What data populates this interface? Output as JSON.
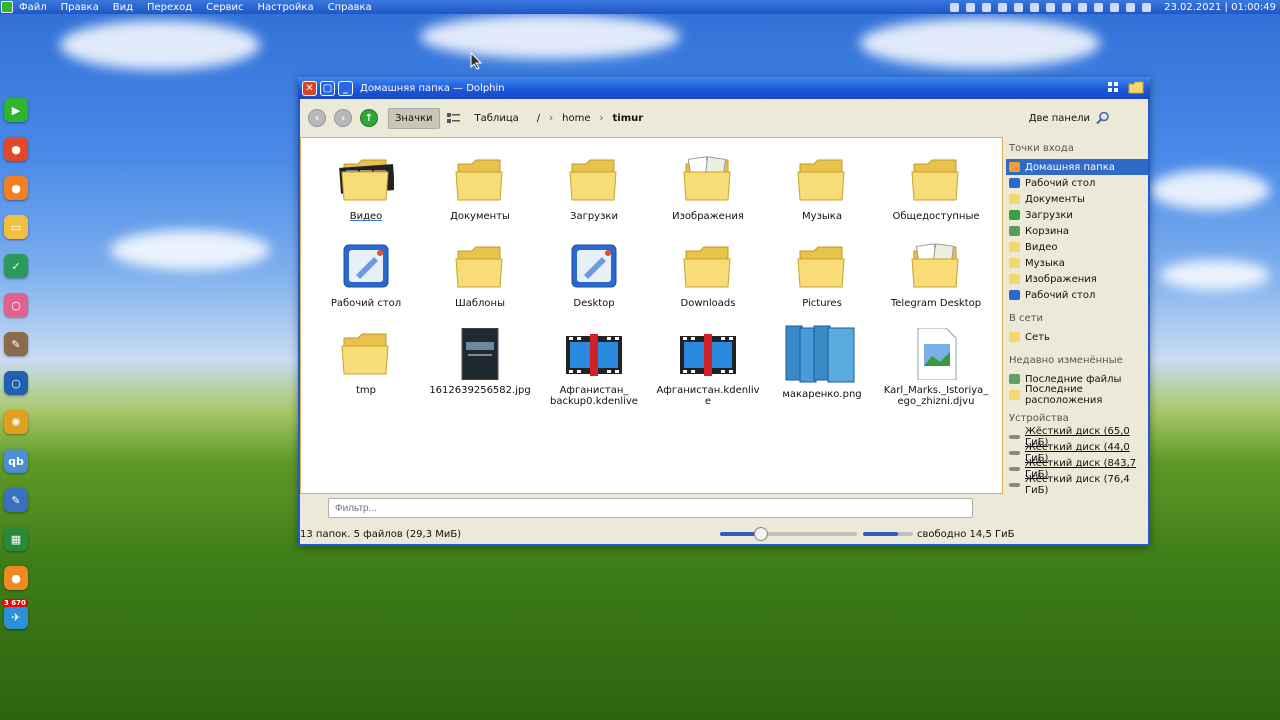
{
  "menubar": {
    "items": [
      "Файл",
      "Правка",
      "Вид",
      "Переход",
      "Сервис",
      "Настройка",
      "Справка"
    ],
    "clock": "23.02.2021 | 01:00:49"
  },
  "dock": {
    "items": [
      {
        "name": "play-icon",
        "color": "#2fb52f",
        "glyph": "▶"
      },
      {
        "name": "chrome-icon",
        "color": "#e04a2a",
        "glyph": "●"
      },
      {
        "name": "firefox-icon",
        "color": "#f08020",
        "glyph": "●"
      },
      {
        "name": "folder-icon",
        "color": "#f0c040",
        "glyph": "▭"
      },
      {
        "name": "graph-icon",
        "color": "#2a9a5a",
        "glyph": "✓"
      },
      {
        "name": "disc-icon",
        "color": "#e06090",
        "glyph": "○"
      },
      {
        "name": "gimp-icon",
        "color": "#8a6a4a",
        "glyph": "✎"
      },
      {
        "name": "globe-icon",
        "color": "#2060b0",
        "glyph": "○"
      },
      {
        "name": "color-wheel-icon",
        "color": "#e0a020",
        "glyph": "✺"
      },
      {
        "name": "qbittorrent-icon",
        "color": "#4a90d0",
        "glyph": "qb"
      },
      {
        "name": "document-edit-icon",
        "color": "#3a70c0",
        "glyph": "✎"
      },
      {
        "name": "image-viewer-icon",
        "color": "#2a8a3a",
        "glyph": "▦"
      },
      {
        "name": "orange-icon",
        "color": "#f08a20",
        "glyph": "●"
      },
      {
        "name": "telegram-icon",
        "color": "#2a90d8",
        "glyph": "✈",
        "badge": "3 670"
      }
    ]
  },
  "window": {
    "title": "Домашняя папка — Dolphin",
    "toolbar": {
      "view_icons": "Значки",
      "view_table": "Таблица",
      "crumb_root": "/",
      "crumb_home": "home",
      "crumb_current": "timur",
      "dual_panel": "Две панели"
    },
    "files": [
      {
        "label": "Видео",
        "type": "video-folder",
        "selected": true
      },
      {
        "label": "Документы",
        "type": "folder"
      },
      {
        "label": "Загрузки",
        "type": "folder"
      },
      {
        "label": "Изображения",
        "type": "images-folder"
      },
      {
        "label": "Музыка",
        "type": "folder"
      },
      {
        "label": "Общедоступные",
        "type": "folder"
      },
      {
        "label": "Рабочий стол",
        "type": "desktop"
      },
      {
        "label": "Шаблоны",
        "type": "folder"
      },
      {
        "label": "Desktop",
        "type": "desktop"
      },
      {
        "label": "Downloads",
        "type": "folder"
      },
      {
        "label": "Pictures",
        "type": "folder"
      },
      {
        "label": "Telegram Desktop",
        "type": "images-folder"
      },
      {
        "label": "tmp",
        "type": "tmp-folder"
      },
      {
        "label": "1612639256582.jpg",
        "type": "book-image"
      },
      {
        "label": "Афганистан_ backup0.kdenlive",
        "type": "film"
      },
      {
        "label": "Афганистан.kdenlive",
        "type": "film"
      },
      {
        "label": "макаренко.png",
        "type": "books"
      },
      {
        "label": "Karl_Marks._Istoriya_ ego_zhizni.djvu",
        "type": "djvu"
      }
    ],
    "sidebar": {
      "places_title": "Точки входа",
      "places": [
        {
          "label": "Домашняя папка",
          "icon": "home-icon",
          "active": true
        },
        {
          "label": "Рабочий стол",
          "icon": "desktop-icon"
        },
        {
          "label": "Документы",
          "icon": "folder-icon"
        },
        {
          "label": "Загрузки",
          "icon": "downloads-icon"
        },
        {
          "label": "Корзина",
          "icon": "trash-icon"
        },
        {
          "label": "Видео",
          "icon": "folder-icon"
        },
        {
          "label": "Музыка",
          "icon": "folder-icon"
        },
        {
          "label": "Изображения",
          "icon": "folder-icon"
        },
        {
          "label": "Рабочий стол",
          "icon": "desktop-icon"
        }
      ],
      "network_title": "В сети",
      "network": [
        {
          "label": "Сеть",
          "icon": "folder-icon"
        }
      ],
      "recent_title": "Недавно изменённые",
      "recent": [
        {
          "label": "Последние файлы",
          "icon": "recent-files-icon"
        },
        {
          "label": "Последние расположения",
          "icon": "folder-icon"
        }
      ],
      "devices_title": "Устройства",
      "devices": [
        {
          "label": "Жёсткий диск (65,0 ГиБ)",
          "icon": "hard-disk-icon",
          "underline": true
        },
        {
          "label": "Жёсткий диск (44,0 ГиБ)",
          "icon": "hard-disk-icon",
          "underline": true
        },
        {
          "label": "Жёсткий диск (843,7 ГиБ)",
          "icon": "hard-disk-icon",
          "underline": true
        },
        {
          "label": "Жёсткий диск (76,4 ГиБ)",
          "icon": "hard-disk-icon",
          "underline": false
        }
      ]
    },
    "filter_placeholder": "Фильтр...",
    "status": "13 папок. 5 файлов (29,3 МиБ)",
    "zoom_level": 0.3,
    "free_space_used_fraction": 0.7,
    "free_space": "свободно 14,5 ГиБ"
  },
  "colors": {
    "accent": "#3169c6",
    "titlebar": "#1a55d8",
    "folder": "#f5d76e"
  }
}
